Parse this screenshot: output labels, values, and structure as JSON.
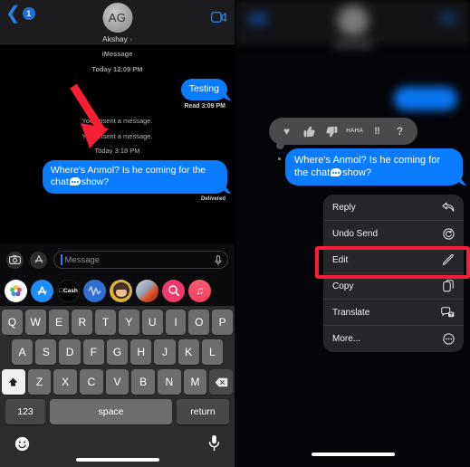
{
  "left_panel": {
    "nav": {
      "back_badge": "1",
      "back_icon": "chevron-left-icon",
      "contact_initials": "AG",
      "contact_name": "Akshay",
      "contact_chevron": "›",
      "facetime_icon": "video-camera-icon"
    },
    "thread": {
      "service_label": "iMessage",
      "service_time": "Today 12:09 PM",
      "first_message": "Testing",
      "first_status": "Read 3:09 PM",
      "unsent_1": "You unsent a message.",
      "unsent_2": "You unsent a message.",
      "second_timestamp": "Today 3:18 PM",
      "second_message_part1": "Where's Anmol? Is he coming for the chat",
      "second_message_part2": "show?",
      "second_status": "Delivered"
    },
    "input_bar": {
      "camera_icon": "camera-icon",
      "apps_icon": "app-store-icon",
      "placeholder": "Message",
      "mic_icon": "microphone-icon"
    },
    "app_drawer": [
      {
        "name": "photos-app-icon",
        "label": ""
      },
      {
        "name": "app-store-app-icon",
        "label": ""
      },
      {
        "name": "apple-cash-app-icon",
        "label": "Cash"
      },
      {
        "name": "digital-touch-app-icon",
        "label": ""
      },
      {
        "name": "memoji-app-icon",
        "label": ""
      },
      {
        "name": "stickers-app-icon",
        "label": ""
      },
      {
        "name": "images-search-app-icon",
        "label": ""
      },
      {
        "name": "music-app-icon",
        "label": ""
      }
    ],
    "keyboard": {
      "row1": [
        "Q",
        "W",
        "E",
        "R",
        "T",
        "Y",
        "U",
        "I",
        "O",
        "P"
      ],
      "row2": [
        "A",
        "S",
        "D",
        "F",
        "G",
        "H",
        "J",
        "K",
        "L"
      ],
      "row3": [
        "Z",
        "X",
        "C",
        "V",
        "B",
        "N",
        "M"
      ],
      "shift_icon": "shift-arrow-icon",
      "backspace_icon": "backspace-icon",
      "numbers_key": "123",
      "space_key": "space",
      "return_key": "return",
      "emoji_icon": "emoji-smiley-icon",
      "dictation_icon": "microphone-icon"
    },
    "annotation": {
      "arrow": "red-arrow-pointing-down-right"
    }
  },
  "right_panel": {
    "tapbacks": [
      {
        "name": "heart-tapback",
        "glyph": "♥"
      },
      {
        "name": "thumbs-up-tapback",
        "glyph": "👍"
      },
      {
        "name": "thumbs-down-tapback",
        "glyph": "👎"
      },
      {
        "name": "haha-tapback",
        "glyph": "HA\nHA"
      },
      {
        "name": "exclamation-tapback",
        "glyph": "‼"
      },
      {
        "name": "question-tapback",
        "glyph": "?"
      }
    ],
    "haha_line1": "HA",
    "haha_line2": "HA",
    "focused_message_part1": "Where's Anmol? Is he coming for the chat",
    "focused_message_part2": "show?",
    "context_menu": [
      {
        "label": "Reply",
        "icon": "reply-arrow-icon",
        "highlighted": false
      },
      {
        "label": "Undo Send",
        "icon": "undo-circle-icon",
        "highlighted": false
      },
      {
        "label": "Edit",
        "icon": "pencil-icon",
        "highlighted": true
      },
      {
        "label": "Copy",
        "icon": "copy-document-icon",
        "highlighted": false
      },
      {
        "label": "Translate",
        "icon": "translate-bubbles-icon",
        "highlighted": false
      },
      {
        "label": "More...",
        "icon": "more-ellipsis-circle-icon",
        "highlighted": false
      }
    ],
    "highlight_color": "#fa1e32"
  },
  "colors": {
    "imessage_blue": "#0a7cff",
    "annotation_red": "#fa1e32",
    "nav_background": "#1c1c1e",
    "keyboard_background": "#2c2c2e"
  }
}
